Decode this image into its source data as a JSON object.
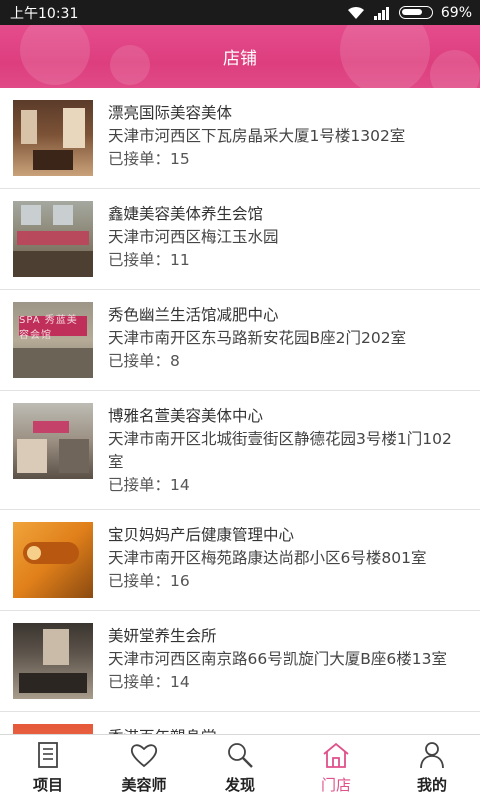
{
  "status_bar": {
    "time": "上午10:31",
    "battery": "69%"
  },
  "header": {
    "title": "店铺"
  },
  "stores": [
    {
      "name": "漂亮国际美容美体",
      "address": "天津市河西区下瓦房晶采大厦1号楼1302室",
      "orders": "已接单：15"
    },
    {
      "name": "鑫婕美容美体养生会馆",
      "address": "天津市河西区梅江玉水园",
      "orders": "已接单：11"
    },
    {
      "name": "秀色幽兰生活馆减肥中心",
      "address": "天津市南开区东马路新安花园B座2门202室",
      "orders": "已接单：8",
      "sign": "SPA 秀蓝美容会馆"
    },
    {
      "name": "博雅名萱美容美体中心",
      "address": "天津市南开区北城街壹街区静德花园3号楼1门102室",
      "orders": "已接单：14"
    },
    {
      "name": "宝贝妈妈产后健康管理中心",
      "address": "天津市南开区梅苑路康达尚郡小区6号楼801室",
      "orders": "已接单：16"
    },
    {
      "name": "美妍堂养生会所",
      "address": "天津市河西区南京路66号凯旋门大厦B座6楼13室",
      "orders": "已接单：14"
    },
    {
      "name": "香港百年塑身堂",
      "address": "",
      "orders": ""
    }
  ],
  "nav": [
    {
      "label": "项目",
      "icon": "document-icon"
    },
    {
      "label": "美容师",
      "icon": "heart-icon"
    },
    {
      "label": "发现",
      "icon": "magnifier-icon"
    },
    {
      "label": "门店",
      "icon": "storefront-icon",
      "active": true
    },
    {
      "label": "我的",
      "icon": "person-icon"
    }
  ],
  "colors": {
    "header": "#e54c8c",
    "active_nav": "#e0518b"
  }
}
